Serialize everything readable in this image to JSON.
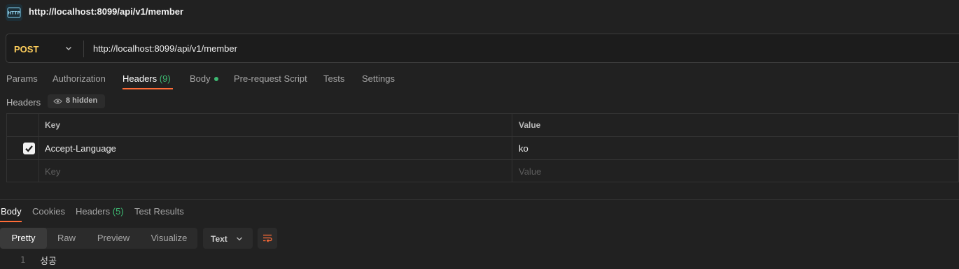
{
  "request": {
    "title": "http://localhost:8099/api/v1/member",
    "method": "POST",
    "url": "http://localhost:8099/api/v1/member",
    "tabs": [
      {
        "label": "Params"
      },
      {
        "label": "Authorization"
      },
      {
        "label": "Headers",
        "count": "(9)",
        "active": true
      },
      {
        "label": "Body",
        "has_dot": true
      },
      {
        "label": "Pre-request Script"
      },
      {
        "label": "Tests"
      },
      {
        "label": "Settings"
      }
    ]
  },
  "headers_section": {
    "label": "Headers",
    "hidden_badge": "8 hidden",
    "columns": {
      "key": "Key",
      "value": "Value"
    },
    "rows": [
      {
        "checked": true,
        "key": "Accept-Language",
        "value": "ko"
      }
    ],
    "placeholder": {
      "key": "Key",
      "value": "Value"
    }
  },
  "response": {
    "tabs": [
      {
        "label": "Body",
        "active": true
      },
      {
        "label": "Cookies"
      },
      {
        "label": "Headers",
        "count": "(5)"
      },
      {
        "label": "Test Results"
      }
    ],
    "view_modes": [
      "Pretty",
      "Raw",
      "Preview",
      "Visualize"
    ],
    "active_view_mode": "Pretty",
    "format": "Text",
    "lines": [
      {
        "number": "1",
        "text": "성공"
      }
    ]
  },
  "colors": {
    "method_post": "#ffcf5c",
    "active_tab_underline": "#ff6c37",
    "count_green": "#3db972",
    "background": "#212121"
  },
  "icons": {
    "request_type": "http-request-icon",
    "method_dropdown": "chevron-down-icon",
    "hidden_headers": "eye-icon",
    "checkbox": "check-icon",
    "format_dropdown": "chevron-down-icon",
    "wrap_lines": "wrap-lines-icon"
  }
}
